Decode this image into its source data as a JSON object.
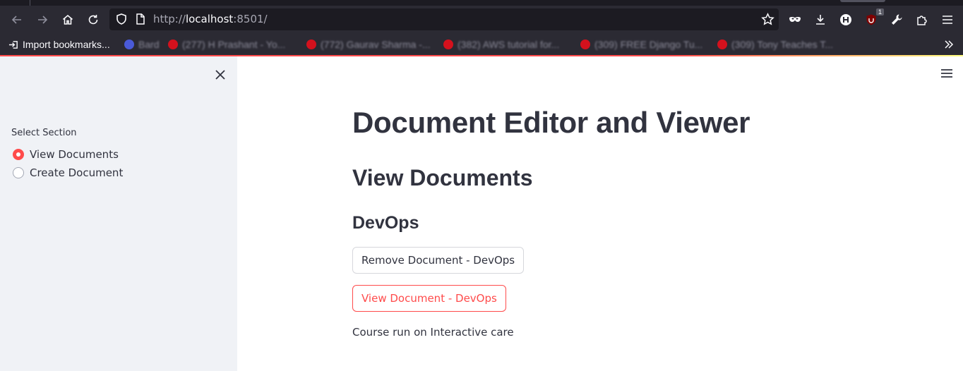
{
  "browser": {
    "url_prefix": "http://",
    "url_host": "localhost",
    "url_rest": ":8501/",
    "extension_badge": "1",
    "bookmarks": [
      {
        "label": "Import bookmarks...",
        "blurred": false
      },
      {
        "label": "Bard",
        "blurred": true
      },
      {
        "label": "(277) H Prashant - Yo...",
        "blurred": true
      },
      {
        "label": "(772) Gaurav Sharma -...",
        "blurred": true
      },
      {
        "label": "(382) AWS tutorial for...",
        "blurred": true
      },
      {
        "label": "(309) FREE Django Tu...",
        "blurred": true
      },
      {
        "label": "(309) Tony Teaches T...",
        "blurred": true
      }
    ]
  },
  "sidebar": {
    "label": "Select Section",
    "options": [
      {
        "label": "View Documents",
        "selected": true
      },
      {
        "label": "Create Document",
        "selected": false
      }
    ]
  },
  "main": {
    "title": "Document Editor and Viewer",
    "section_heading": "View Documents",
    "doc_heading": "DevOps",
    "remove_button": "Remove Document - DevOps",
    "view_button": "View Document - DevOps",
    "description": "Course run on Interactive care"
  },
  "colors": {
    "accent": "#ff4b4b",
    "text": "#31333f",
    "sidebar_bg": "#f0f2f6"
  }
}
